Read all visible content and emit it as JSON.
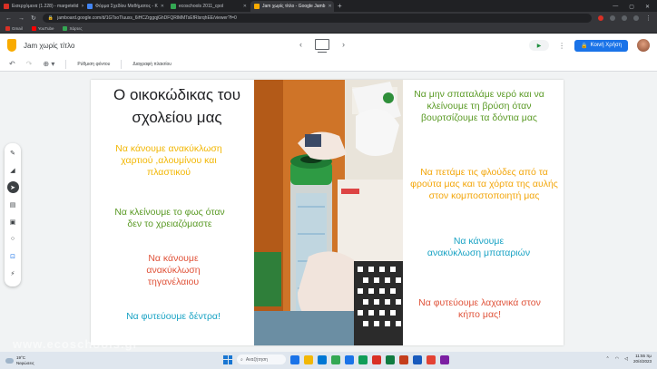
{
  "browser": {
    "tabs": [
      {
        "title": "Εισερχόμενα (1.228) - margetelid",
        "color": "#d93025",
        "active": false
      },
      {
        "title": "Φόρμα Σχεδίου Μαθήματος - K",
        "color": "#4285f4",
        "active": false
      },
      {
        "title": "ecoschools 2011_cpol",
        "color": "#34a853",
        "active": false
      },
      {
        "title": "Jam χωρίς τίτλο - Google Jamb",
        "color": "#f9ab00",
        "active": true
      }
    ],
    "url": "jamboard.google.com/d/1GTsoTluuxs_6iHCZrggqjGhDFQRlMMTsEfRlsrqhEE/viewer?f=0",
    "bookmarks": [
      {
        "label": "Gmail",
        "color": "#d93025"
      },
      {
        "label": "YouTube",
        "color": "#ff0000"
      },
      {
        "label": "Χάρτες",
        "color": "#34a853"
      }
    ]
  },
  "jamboard": {
    "title": "Jam χωρίς τίτλο",
    "share_label": "Κοινή Χρήση",
    "toolbar": {
      "frame_bg": "Ρύθμιση φόντου",
      "clear": "Διαγραφή πλαισίου"
    }
  },
  "frame": {
    "heading": "Ο οικοκώδικας του σχολείου μας",
    "left_notes": [
      {
        "text": "Να κάνουμε ανακύκλωση χαρτιού ,αλουμίνου και πλαστικού",
        "color": "yellow"
      },
      {
        "text": "Να κλείνουμε το φως όταν δεν το χρειαζόμαστε",
        "color": "green"
      },
      {
        "text": "Να κάνουμε ανακύκλωση τηγανέλαιου",
        "color": "red"
      },
      {
        "text": "Να φυτεύουμε δέντρα!",
        "color": "teal"
      }
    ],
    "right_notes": [
      {
        "text": "Να μην σπαταλάμε νερό και να κλείνουμε τη βρύση όταν βουρτσίζουμε τα δόντια μας",
        "color": "green"
      },
      {
        "text": "Να πετάμε τις φλούδες από τα φρούτα μας και τα χόρτα της αυλής στον κομποστοποιητή μας",
        "color": "orange"
      },
      {
        "text": "Να κάνουμε ανακύκλωση μπαταριών",
        "color": "teal"
      },
      {
        "text": "Να φυτεύουμε λαχανικά στον κήπο μας!",
        "color": "red"
      }
    ],
    "photo_alt": "Children recycling batteries into a green recycling box"
  },
  "taskbar": {
    "temp": "19°C",
    "weather": "Νεφώσεις",
    "search": "Αναζήτηση",
    "time": "11:55 πμ",
    "date": "20/4/2023",
    "apps": [
      "#1a73e8",
      "#f2b705",
      "#0078d4",
      "#34a853",
      "#1a73e8",
      "#0f9d58",
      "#d93025",
      "#107c41",
      "#c43e1c",
      "#185abd",
      "#e34234",
      "#7b1fa2"
    ]
  },
  "watermark": "www.ecoschools.gr"
}
